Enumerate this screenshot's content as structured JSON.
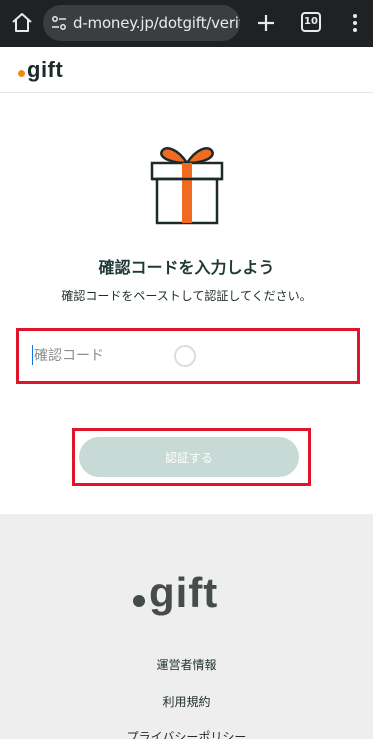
{
  "browser": {
    "url": "d-money.jp/dotgift/verify",
    "tab_count": "10"
  },
  "header": {
    "logo_text": "gift"
  },
  "main": {
    "title": "確認コードを入力しよう",
    "subtitle": "確認コードをペーストして認証してください。",
    "code_input": {
      "placeholder": "確認コード",
      "value": ""
    },
    "verify_button_label": "認証する"
  },
  "footer": {
    "logo_text": "gift",
    "links": [
      "運営者情報",
      "利用規約",
      "プライバシーポリシー"
    ]
  },
  "colors": {
    "brand_orange": "#f08a1f",
    "button_disabled": "#c8dad5",
    "highlight_red": "#e0142b",
    "footer_bg": "#eeeeee"
  }
}
